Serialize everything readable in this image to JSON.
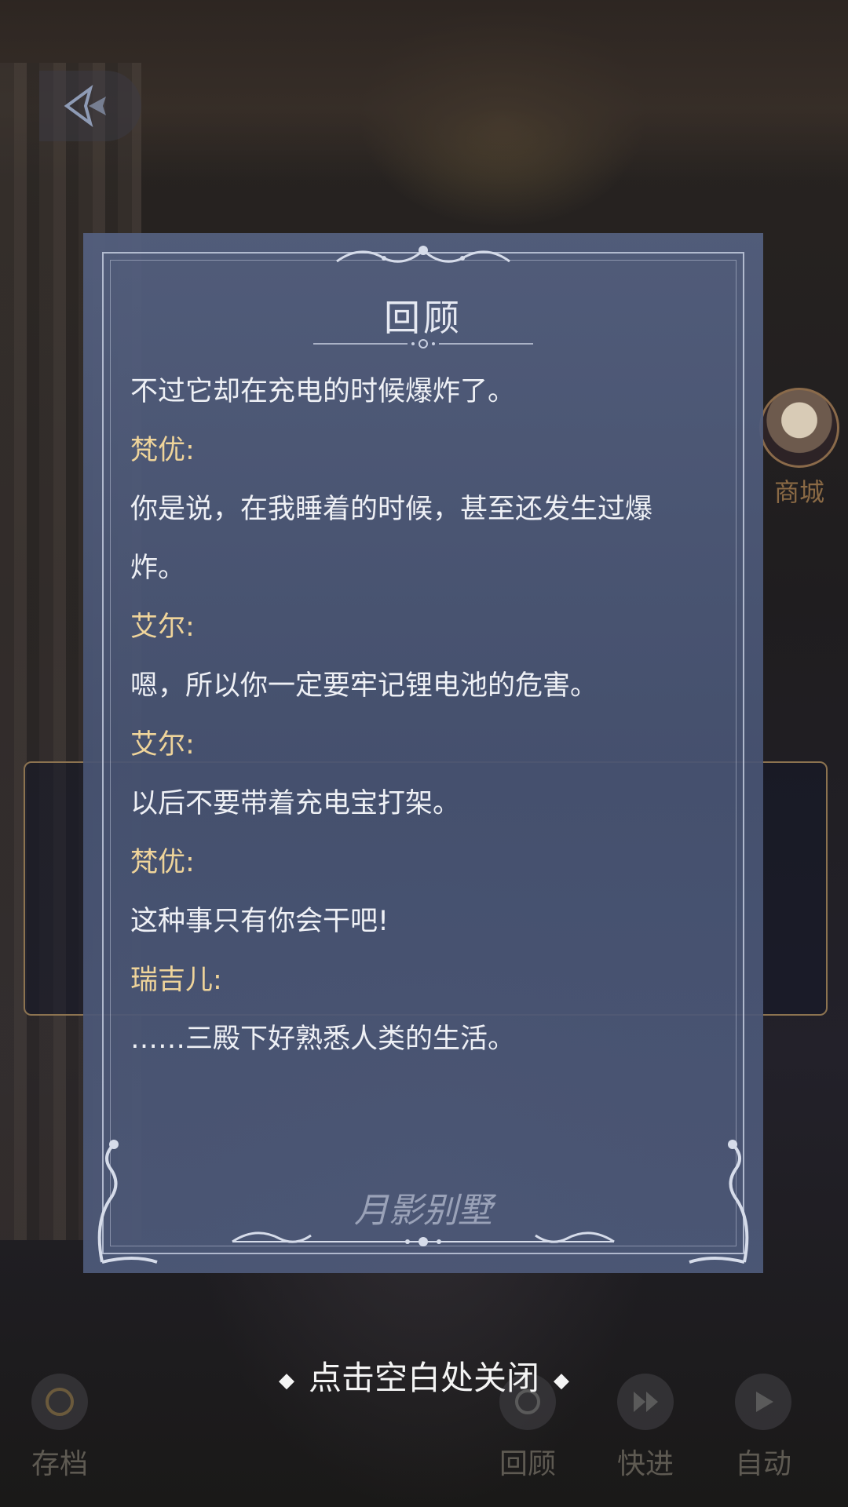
{
  "panel": {
    "title": "回顾",
    "watermark": "月影别墅"
  },
  "log": [
    {
      "type": "text",
      "text": "不过它却在充电的时候爆炸了。"
    },
    {
      "type": "speaker",
      "text": "梵优:"
    },
    {
      "type": "text",
      "text": "你是说，在我睡着的时候，甚至还发生过爆"
    },
    {
      "type": "text",
      "text": "炸。"
    },
    {
      "type": "speaker",
      "text": "艾尔:"
    },
    {
      "type": "text",
      "text": "嗯，所以你一定要牢记锂电池的危害。"
    },
    {
      "type": "speaker",
      "text": "艾尔:"
    },
    {
      "type": "text",
      "text": "以后不要带着充电宝打架。"
    },
    {
      "type": "speaker",
      "text": "梵优:"
    },
    {
      "type": "text",
      "text": "这种事只有你会干吧!"
    },
    {
      "type": "speaker",
      "text": "瑞吉儿:"
    },
    {
      "type": "text",
      "text": "……三殿下好熟悉人类的生活。"
    }
  ],
  "close_hint": "点击空白处关闭",
  "shop": {
    "label": "商城"
  },
  "bottom_bar": {
    "save": "存档",
    "review": "回顾",
    "fast": "快进",
    "auto": "自动"
  },
  "colors": {
    "speaker": "#efd49a",
    "text": "#eef0f5",
    "panel": "#4f5b7a"
  }
}
